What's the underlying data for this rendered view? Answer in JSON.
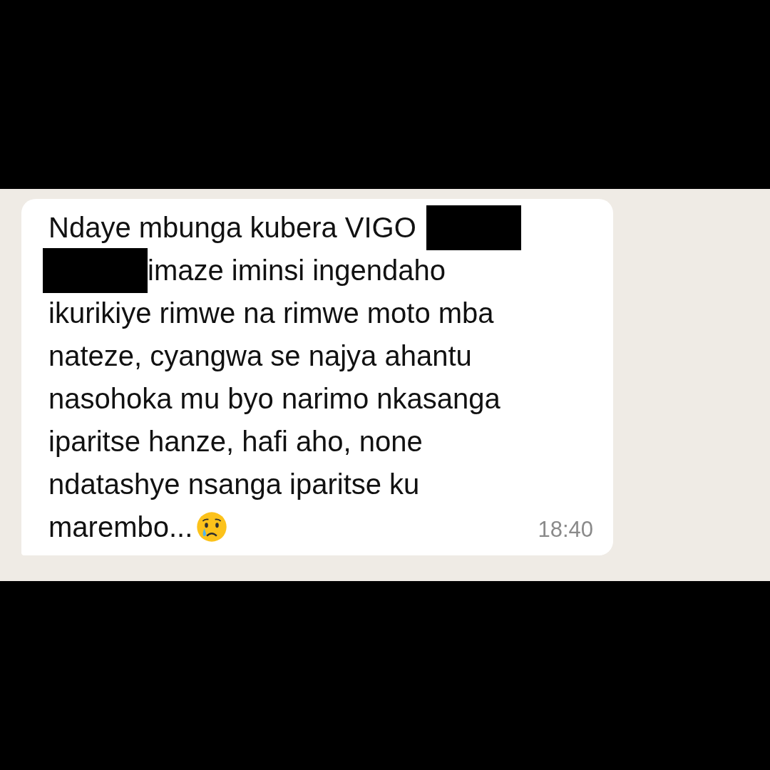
{
  "message": {
    "lines": [
      {
        "segments": [
          {
            "kind": "text",
            "text": "Ndaye mbunga kubera VIGO"
          },
          {
            "kind": "redaction"
          }
        ]
      },
      {
        "segments": [
          {
            "kind": "redaction"
          },
          {
            "kind": "text",
            "text": "imaze iminsi ingendaho"
          }
        ]
      },
      {
        "segments": [
          {
            "kind": "text",
            "text": "ikurikiye rimwe na rimwe moto mba"
          }
        ]
      },
      {
        "segments": [
          {
            "kind": "text",
            "text": "nateze, cyangwa se najya ahantu"
          }
        ]
      },
      {
        "segments": [
          {
            "kind": "text",
            "text": "nasohoka mu byo narimo nkasanga"
          }
        ]
      },
      {
        "segments": [
          {
            "kind": "text",
            "text": "iparitse hanze, hafi aho, none"
          }
        ]
      },
      {
        "segments": [
          {
            "kind": "text",
            "text": "ndatashye nsanga iparitse ku"
          }
        ]
      },
      {
        "segments": [
          {
            "kind": "text",
            "text": "marembo..."
          },
          {
            "kind": "emoji"
          }
        ]
      }
    ],
    "time": "18:40"
  }
}
